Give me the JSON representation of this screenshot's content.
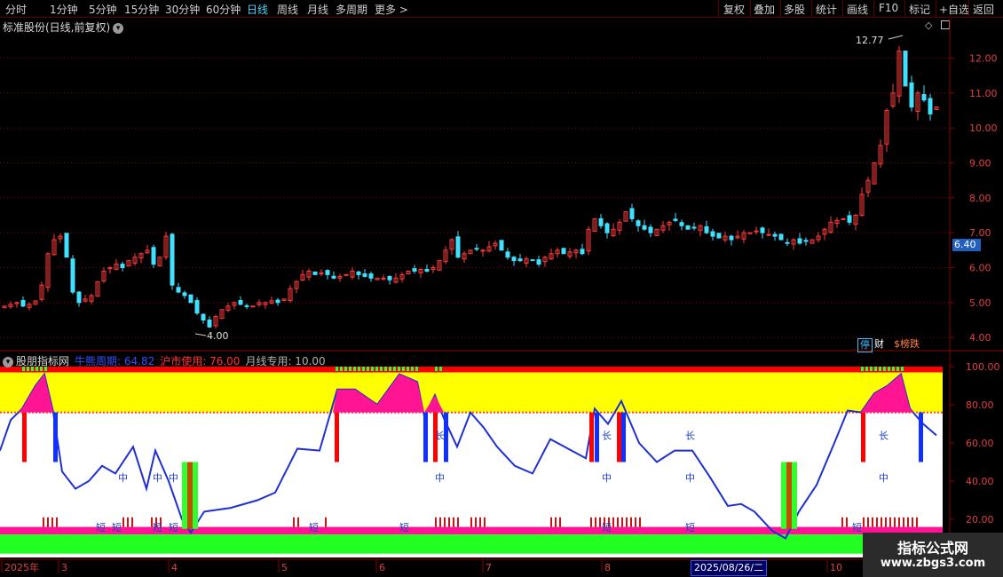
{
  "toolbar": {
    "periods": [
      "分时",
      "1分钟",
      "5分钟",
      "15分钟",
      "30分钟",
      "60分钟",
      "日线",
      "周线",
      "月线",
      "多周期",
      "更多 >"
    ],
    "active_period": "日线",
    "actions": [
      "复权",
      "叠加",
      "多股",
      "统计",
      "画线",
      "F10",
      "标记",
      "+自选",
      "返回"
    ]
  },
  "chart_header": {
    "title": "标准股份(日线,前复权)"
  },
  "price_axis": {
    "labels": [
      "12.00",
      "11.00",
      "10.00",
      "9.00",
      "8.00",
      "7.00",
      "6.00",
      "5.00",
      "4.00"
    ]
  },
  "current_price": "6.40",
  "annotations": {
    "high": "12.77",
    "low": "4.00"
  },
  "badges": [
    {
      "text": "停",
      "color": "#40c0ff"
    },
    {
      "text": "财",
      "color": "#ffffff"
    },
    {
      "text": "$榜跌",
      "color": "#ff8040"
    }
  ],
  "indicator": {
    "name": "股朋指标网",
    "v1_label": "牛熊周期: 64.82",
    "v2_label": "沪市使用: 76.00",
    "v3_label": "月线专用: 10.00",
    "axis_labels": [
      "100.00",
      "80.00",
      "60.00",
      "40.00",
      "20.00"
    ],
    "tags_chang": "长",
    "tags_zhong": "中",
    "tags_duan": "短"
  },
  "date_axis": {
    "labels": [
      "2025年",
      "3",
      "4",
      "5",
      "6",
      "7",
      "8",
      "10"
    ],
    "cursor_date": "2025/08/26/二"
  },
  "watermark": {
    "line1": "指标公式网",
    "line2": "www.zbgs3.com"
  },
  "colors": {
    "up": "#ff3a3a",
    "down": "#40e0ff",
    "grid": "#8a0000",
    "line": "#1e30d0",
    "band_yellow": "#ffff00",
    "band_magenta": "#ff1493",
    "band_green": "#22ff22",
    "band_red": "#ff0000"
  },
  "chart_data": {
    "type": "candlestick",
    "y_range": [
      3.7,
      12.9
    ],
    "indicator_range": [
      0,
      100
    ],
    "candles_close": [
      4.9,
      4.95,
      5.0,
      4.9,
      4.95,
      5.05,
      5.5,
      6.4,
      6.8,
      6.9,
      6.3,
      5.3,
      5.0,
      5.1,
      5.2,
      5.6,
      5.9,
      6.0,
      6.1,
      6.0,
      6.2,
      6.3,
      6.4,
      6.5,
      6.1,
      6.3,
      6.9,
      5.5,
      5.3,
      5.2,
      5.0,
      4.7,
      4.5,
      4.3,
      4.6,
      4.8,
      4.9,
      5.0,
      4.95,
      4.9,
      4.9,
      5.0,
      5.0,
      5.05,
      5.0,
      5.1,
      5.4,
      5.6,
      5.8,
      5.9,
      5.8,
      5.85,
      5.8,
      5.7,
      5.75,
      5.8,
      5.9,
      5.8,
      5.75,
      5.7,
      5.7,
      5.7,
      5.65,
      5.7,
      5.8,
      5.9,
      5.9,
      5.95,
      5.9,
      6.0,
      6.2,
      6.5,
      6.8,
      6.3,
      6.4,
      6.5,
      6.55,
      6.5,
      6.6,
      6.7,
      6.5,
      6.3,
      6.2,
      6.2,
      6.25,
      6.2,
      6.1,
      6.3,
      6.4,
      6.5,
      6.4,
      6.45,
      6.5,
      6.4,
      7.1,
      7.4,
      7.2,
      7.0,
      7.1,
      7.3,
      7.6,
      7.4,
      7.2,
      7.1,
      7.0,
      7.1,
      7.2,
      7.3,
      7.35,
      7.2,
      7.1,
      7.15,
      7.2,
      7.0,
      6.9,
      6.85,
      6.9,
      6.8,
      6.9,
      7.0,
      7.0,
      7.05,
      7.0,
      6.95,
      6.9,
      6.8,
      6.7,
      6.8,
      6.7,
      6.75,
      6.8,
      6.9,
      7.1,
      7.3,
      7.35,
      7.4,
      7.3,
      7.5,
      8.1,
      8.5,
      9.0,
      9.5,
      10.5,
      11.0,
      12.2,
      11.2,
      10.6,
      11.0,
      10.8,
      10.4,
      10.6
    ]
  }
}
